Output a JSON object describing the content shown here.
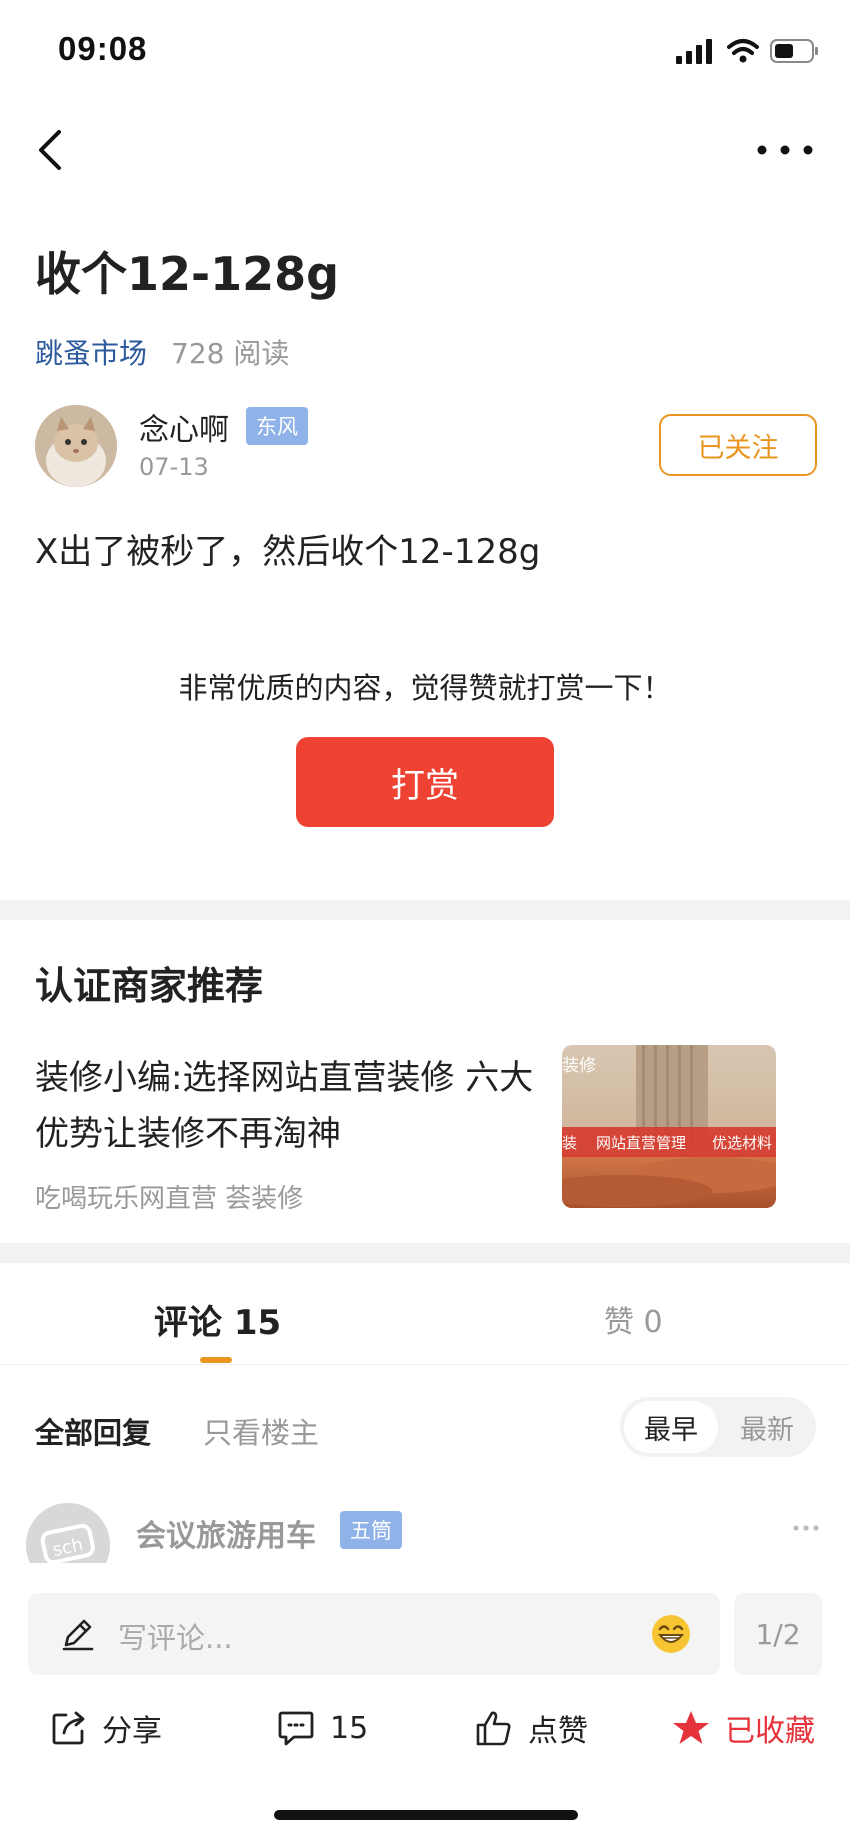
{
  "status_bar": {
    "time": "09:08"
  },
  "post": {
    "title": "收个12-128g",
    "forum": "跳蚤市场",
    "read_count": "728 阅读",
    "author": {
      "name": "念心啊",
      "badge": "东风",
      "date": "07-13",
      "follow_label": "已关注"
    },
    "body": "X出了被秒了，然后收个12-128g"
  },
  "reward": {
    "prompt": "非常优质的内容，觉得赞就打赏一下！",
    "button_label": "打赏"
  },
  "recommend": {
    "section_title": "认证商家推荐",
    "ad_title": "装修小编:选择网站直营装修 六大优势让装修不再淘神",
    "ad_source": "吃喝玩乐网直营 荟装修",
    "thumb_banner": [
      "装",
      "网站直营管理",
      "优选材料"
    ],
    "thumb_top_text": "装修"
  },
  "tabs": {
    "comments": "评论 15",
    "likes": "赞 0"
  },
  "filters": {
    "all": "全部回复",
    "op_only": "只看楼主",
    "sort_early": "最早",
    "sort_new": "最新"
  },
  "comment": {
    "name": "会议旅游用车",
    "badge": "五筒",
    "avatar_text": "sch"
  },
  "bottom_bar": {
    "input_placeholder": "写评论...",
    "page": "1/2",
    "share_label": "分享",
    "comment_count": "15",
    "like_label": "点赞",
    "favorite_label": "已收藏"
  },
  "colors": {
    "accent": "#e8961f",
    "reward": "#ee4233",
    "favorite": "#e5323b",
    "link": "#2c5a9c",
    "badge": "#8fb2e8"
  }
}
